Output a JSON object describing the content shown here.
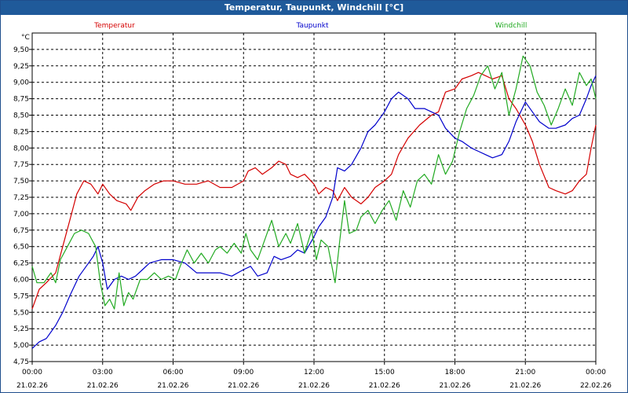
{
  "window_title": "Temperatur, Taupunkt, Windchill [°C]",
  "chart_data": {
    "type": "line",
    "title": "Temperatur, Taupunkt, Windchill [°C]",
    "ylabel": "°C",
    "xlabel": "",
    "ylim": [
      4.75,
      9.75
    ],
    "xlim": [
      0,
      24
    ],
    "grid": true,
    "legend_placement": "top",
    "y_ticks": [
      "4,75",
      "5,00",
      "5,25",
      "5,50",
      "5,75",
      "6,00",
      "6,25",
      "6,50",
      "6,75",
      "7,00",
      "7,25",
      "7,50",
      "7,75",
      "8,00",
      "8,25",
      "8,50",
      "8,75",
      "9,00",
      "9,25",
      "9,50"
    ],
    "x_ticks": [
      {
        "time": "00:00",
        "date": "21.02.26",
        "hour": 0
      },
      {
        "time": "03:00",
        "date": "21.02.26",
        "hour": 3
      },
      {
        "time": "06:00",
        "date": "21.02.26",
        "hour": 6
      },
      {
        "time": "09:00",
        "date": "21.02.26",
        "hour": 9
      },
      {
        "time": "12:00",
        "date": "21.02.26",
        "hour": 12
      },
      {
        "time": "15:00",
        "date": "21.02.26",
        "hour": 15
      },
      {
        "time": "18:00",
        "date": "21.02.26",
        "hour": 18
      },
      {
        "time": "21:00",
        "date": "21.02.26",
        "hour": 21
      },
      {
        "time": "00:00",
        "date": "22.02.26",
        "hour": 24
      }
    ],
    "series": [
      {
        "name": "Temperatur",
        "color": "#d40000",
        "points": [
          [
            0,
            5.55
          ],
          [
            0.3,
            5.85
          ],
          [
            0.6,
            5.95
          ],
          [
            1.0,
            6.1
          ],
          [
            1.3,
            6.5
          ],
          [
            1.6,
            6.9
          ],
          [
            1.9,
            7.3
          ],
          [
            2.2,
            7.5
          ],
          [
            2.5,
            7.45
          ],
          [
            2.8,
            7.3
          ],
          [
            3.0,
            7.45
          ],
          [
            3.3,
            7.3
          ],
          [
            3.6,
            7.2
          ],
          [
            4.0,
            7.15
          ],
          [
            4.2,
            7.05
          ],
          [
            4.5,
            7.25
          ],
          [
            4.8,
            7.35
          ],
          [
            5.2,
            7.45
          ],
          [
            5.6,
            7.5
          ],
          [
            6.0,
            7.5
          ],
          [
            6.5,
            7.45
          ],
          [
            7.0,
            7.45
          ],
          [
            7.5,
            7.5
          ],
          [
            8.0,
            7.4
          ],
          [
            8.5,
            7.4
          ],
          [
            9.0,
            7.5
          ],
          [
            9.2,
            7.65
          ],
          [
            9.5,
            7.7
          ],
          [
            9.8,
            7.6
          ],
          [
            10.2,
            7.7
          ],
          [
            10.5,
            7.8
          ],
          [
            10.8,
            7.75
          ],
          [
            11.0,
            7.6
          ],
          [
            11.3,
            7.55
          ],
          [
            11.6,
            7.6
          ],
          [
            12.0,
            7.45
          ],
          [
            12.2,
            7.3
          ],
          [
            12.5,
            7.4
          ],
          [
            12.8,
            7.35
          ],
          [
            13.0,
            7.2
          ],
          [
            13.3,
            7.4
          ],
          [
            13.6,
            7.25
          ],
          [
            14.0,
            7.15
          ],
          [
            14.3,
            7.25
          ],
          [
            14.6,
            7.4
          ],
          [
            15.0,
            7.5
          ],
          [
            15.3,
            7.6
          ],
          [
            15.6,
            7.9
          ],
          [
            16.0,
            8.15
          ],
          [
            16.5,
            8.35
          ],
          [
            17.0,
            8.5
          ],
          [
            17.3,
            8.55
          ],
          [
            17.6,
            8.85
          ],
          [
            18.0,
            8.9
          ],
          [
            18.3,
            9.05
          ],
          [
            18.7,
            9.1
          ],
          [
            19.0,
            9.15
          ],
          [
            19.3,
            9.1
          ],
          [
            19.6,
            9.05
          ],
          [
            20.0,
            9.1
          ],
          [
            20.3,
            8.75
          ],
          [
            20.6,
            8.6
          ],
          [
            21.0,
            8.35
          ],
          [
            21.3,
            8.1
          ],
          [
            21.6,
            7.75
          ],
          [
            22.0,
            7.4
          ],
          [
            22.3,
            7.35
          ],
          [
            22.7,
            7.3
          ],
          [
            23.0,
            7.35
          ],
          [
            23.3,
            7.5
          ],
          [
            23.6,
            7.6
          ],
          [
            23.8,
            8.0
          ],
          [
            24.0,
            8.35
          ]
        ]
      },
      {
        "name": "Taupunkt",
        "color": "#0000cc",
        "points": [
          [
            0,
            4.95
          ],
          [
            0.3,
            5.05
          ],
          [
            0.6,
            5.1
          ],
          [
            1.0,
            5.3
          ],
          [
            1.3,
            5.5
          ],
          [
            1.6,
            5.75
          ],
          [
            2.0,
            6.05
          ],
          [
            2.3,
            6.2
          ],
          [
            2.6,
            6.35
          ],
          [
            2.8,
            6.5
          ],
          [
            3.0,
            6.25
          ],
          [
            3.2,
            5.85
          ],
          [
            3.5,
            6.0
          ],
          [
            3.8,
            6.05
          ],
          [
            4.1,
            6.0
          ],
          [
            4.4,
            6.05
          ],
          [
            4.7,
            6.15
          ],
          [
            5.0,
            6.25
          ],
          [
            5.5,
            6.3
          ],
          [
            6.0,
            6.3
          ],
          [
            6.5,
            6.25
          ],
          [
            7.0,
            6.1
          ],
          [
            7.5,
            6.1
          ],
          [
            8.0,
            6.1
          ],
          [
            8.5,
            6.05
          ],
          [
            9.0,
            6.15
          ],
          [
            9.3,
            6.2
          ],
          [
            9.6,
            6.05
          ],
          [
            10.0,
            6.1
          ],
          [
            10.3,
            6.35
          ],
          [
            10.6,
            6.3
          ],
          [
            11.0,
            6.35
          ],
          [
            11.3,
            6.45
          ],
          [
            11.6,
            6.4
          ],
          [
            12.0,
            6.65
          ],
          [
            12.2,
            6.8
          ],
          [
            12.5,
            6.95
          ],
          [
            12.8,
            7.25
          ],
          [
            13.0,
            7.7
          ],
          [
            13.3,
            7.65
          ],
          [
            13.6,
            7.75
          ],
          [
            14.0,
            8.0
          ],
          [
            14.3,
            8.25
          ],
          [
            14.6,
            8.35
          ],
          [
            15.0,
            8.55
          ],
          [
            15.3,
            8.75
          ],
          [
            15.6,
            8.85
          ],
          [
            16.0,
            8.75
          ],
          [
            16.3,
            8.6
          ],
          [
            16.7,
            8.6
          ],
          [
            17.0,
            8.55
          ],
          [
            17.3,
            8.5
          ],
          [
            17.6,
            8.3
          ],
          [
            18.0,
            8.15
          ],
          [
            18.3,
            8.1
          ],
          [
            18.7,
            8.0
          ],
          [
            19.0,
            7.95
          ],
          [
            19.3,
            7.9
          ],
          [
            19.6,
            7.85
          ],
          [
            20.0,
            7.9
          ],
          [
            20.3,
            8.1
          ],
          [
            20.6,
            8.4
          ],
          [
            21.0,
            8.7
          ],
          [
            21.3,
            8.55
          ],
          [
            21.6,
            8.4
          ],
          [
            22.0,
            8.3
          ],
          [
            22.3,
            8.3
          ],
          [
            22.7,
            8.35
          ],
          [
            23.0,
            8.45
          ],
          [
            23.3,
            8.5
          ],
          [
            23.6,
            8.75
          ],
          [
            23.8,
            8.95
          ],
          [
            24.0,
            9.1
          ]
        ]
      },
      {
        "name": "Windchill",
        "color": "#22aa22",
        "points": [
          [
            0,
            6.2
          ],
          [
            0.2,
            5.95
          ],
          [
            0.5,
            5.95
          ],
          [
            0.8,
            6.1
          ],
          [
            1.0,
            5.95
          ],
          [
            1.2,
            6.3
          ],
          [
            1.5,
            6.5
          ],
          [
            1.8,
            6.7
          ],
          [
            2.1,
            6.75
          ],
          [
            2.4,
            6.7
          ],
          [
            2.7,
            6.5
          ],
          [
            2.9,
            5.95
          ],
          [
            3.1,
            5.6
          ],
          [
            3.3,
            5.7
          ],
          [
            3.5,
            5.55
          ],
          [
            3.7,
            6.1
          ],
          [
            3.9,
            5.6
          ],
          [
            4.1,
            5.8
          ],
          [
            4.3,
            5.7
          ],
          [
            4.6,
            6.0
          ],
          [
            4.9,
            6.0
          ],
          [
            5.2,
            6.1
          ],
          [
            5.5,
            6.0
          ],
          [
            5.8,
            6.05
          ],
          [
            6.1,
            6.0
          ],
          [
            6.3,
            6.2
          ],
          [
            6.6,
            6.45
          ],
          [
            6.9,
            6.25
          ],
          [
            7.2,
            6.4
          ],
          [
            7.5,
            6.25
          ],
          [
            7.8,
            6.45
          ],
          [
            8.0,
            6.5
          ],
          [
            8.3,
            6.4
          ],
          [
            8.6,
            6.55
          ],
          [
            8.9,
            6.4
          ],
          [
            9.1,
            6.7
          ],
          [
            9.3,
            6.45
          ],
          [
            9.6,
            6.3
          ],
          [
            9.9,
            6.6
          ],
          [
            10.2,
            6.9
          ],
          [
            10.5,
            6.5
          ],
          [
            10.8,
            6.7
          ],
          [
            11.0,
            6.55
          ],
          [
            11.3,
            6.85
          ],
          [
            11.6,
            6.4
          ],
          [
            11.9,
            6.75
          ],
          [
            12.1,
            6.3
          ],
          [
            12.3,
            6.6
          ],
          [
            12.6,
            6.5
          ],
          [
            12.9,
            5.95
          ],
          [
            13.1,
            6.6
          ],
          [
            13.3,
            7.2
          ],
          [
            13.5,
            6.7
          ],
          [
            13.8,
            6.75
          ],
          [
            14.0,
            6.95
          ],
          [
            14.3,
            7.05
          ],
          [
            14.6,
            6.85
          ],
          [
            14.9,
            7.05
          ],
          [
            15.2,
            7.2
          ],
          [
            15.5,
            6.9
          ],
          [
            15.8,
            7.35
          ],
          [
            16.1,
            7.1
          ],
          [
            16.4,
            7.5
          ],
          [
            16.7,
            7.6
          ],
          [
            17.0,
            7.45
          ],
          [
            17.3,
            7.9
          ],
          [
            17.6,
            7.6
          ],
          [
            17.9,
            7.8
          ],
          [
            18.2,
            8.25
          ],
          [
            18.5,
            8.6
          ],
          [
            18.8,
            8.8
          ],
          [
            19.1,
            9.1
          ],
          [
            19.4,
            9.25
          ],
          [
            19.7,
            8.9
          ],
          [
            20.0,
            9.15
          ],
          [
            20.3,
            8.5
          ],
          [
            20.6,
            8.9
          ],
          [
            20.9,
            9.4
          ],
          [
            21.2,
            9.25
          ],
          [
            21.5,
            8.85
          ],
          [
            21.8,
            8.65
          ],
          [
            22.1,
            8.35
          ],
          [
            22.4,
            8.6
          ],
          [
            22.7,
            8.9
          ],
          [
            23.0,
            8.65
          ],
          [
            23.3,
            9.15
          ],
          [
            23.6,
            8.95
          ],
          [
            23.8,
            9.05
          ],
          [
            24.0,
            8.75
          ]
        ]
      }
    ]
  }
}
